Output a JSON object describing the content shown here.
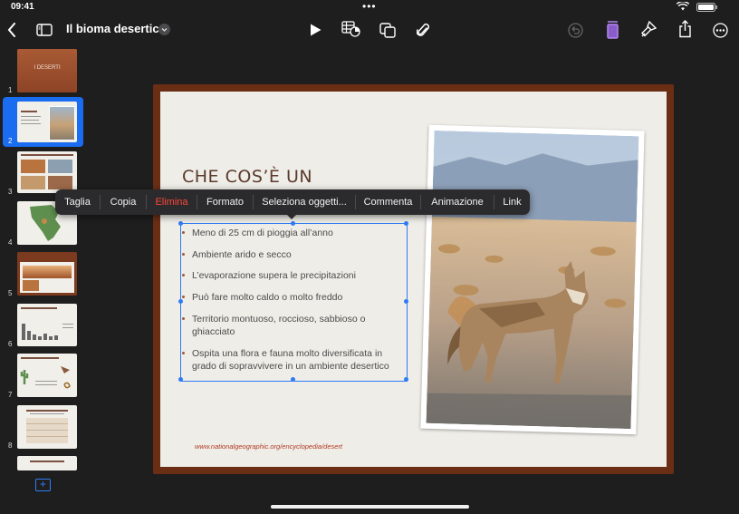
{
  "status": {
    "time": "09:41"
  },
  "document": {
    "title": "Il bioma desertico"
  },
  "slides": [
    {
      "num": "1",
      "title": "I DESERTI"
    },
    {
      "num": "2"
    },
    {
      "num": "3"
    },
    {
      "num": "4"
    },
    {
      "num": "5"
    },
    {
      "num": "6"
    },
    {
      "num": "7"
    },
    {
      "num": "8"
    }
  ],
  "slide": {
    "title": "CHE COS’È UN",
    "bullets": [
      "Meno di 25 cm di pioggia all’anno",
      "Ambiente arido e secco",
      "L’evaporazione supera le precipitazioni",
      "Può fare molto caldo o molto freddo",
      "Territorio montuoso, roccioso, sabbioso o ghiacciato",
      "Ospita una flora e fauna molto diversificata in grado di sopravvivere in un ambiente desertico"
    ],
    "link": "www.nationalgeographic.org/encyclopedia/desert"
  },
  "context_menu": [
    "Taglia",
    "Copia",
    "Elimina",
    "Formato",
    "Seleziona oggetti...",
    "Commenta",
    "Animazione",
    "Link"
  ],
  "colors": {
    "accent": "#2f7bf5",
    "destructive": "#ff453a",
    "slide_frame": "#6a2e15",
    "title_text": "#5a3a2c"
  },
  "icons": [
    "back-chevron-icon",
    "sidebar-icon",
    "play-icon",
    "table-chart-icon",
    "shapes-icon",
    "attachment-icon",
    "undo-icon",
    "format-panel-icon",
    "brush-icon",
    "share-icon",
    "more-icon",
    "add-slide-icon"
  ]
}
